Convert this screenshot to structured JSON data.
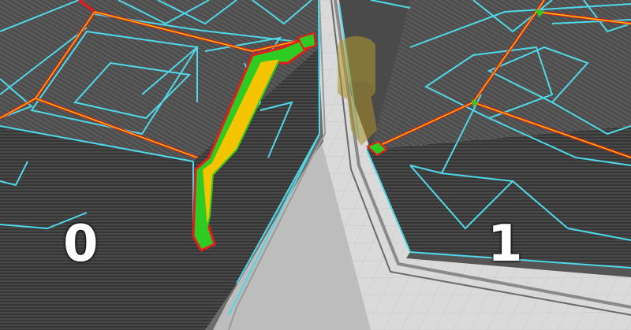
{
  "viewer": {
    "mode": "slicer-preview-comparison",
    "panels": [
      {
        "label": "0"
      },
      {
        "label": "1"
      }
    ]
  },
  "colors": {
    "background": "#d9d9d9",
    "grid_line": "#c4c4c4",
    "print_body": "#3a3a3a",
    "print_top": "#505050",
    "infill_outline": "#4fd8e8",
    "outer_wall": "#e61c1c",
    "inner_wall": "#f5c400",
    "solid_infill": "#2ecc22",
    "nozzle_ghost": "#b39a2e"
  },
  "legend_icons": [
    "print-layer",
    "infill-lines",
    "wall-paths",
    "nozzle-ghost"
  ]
}
